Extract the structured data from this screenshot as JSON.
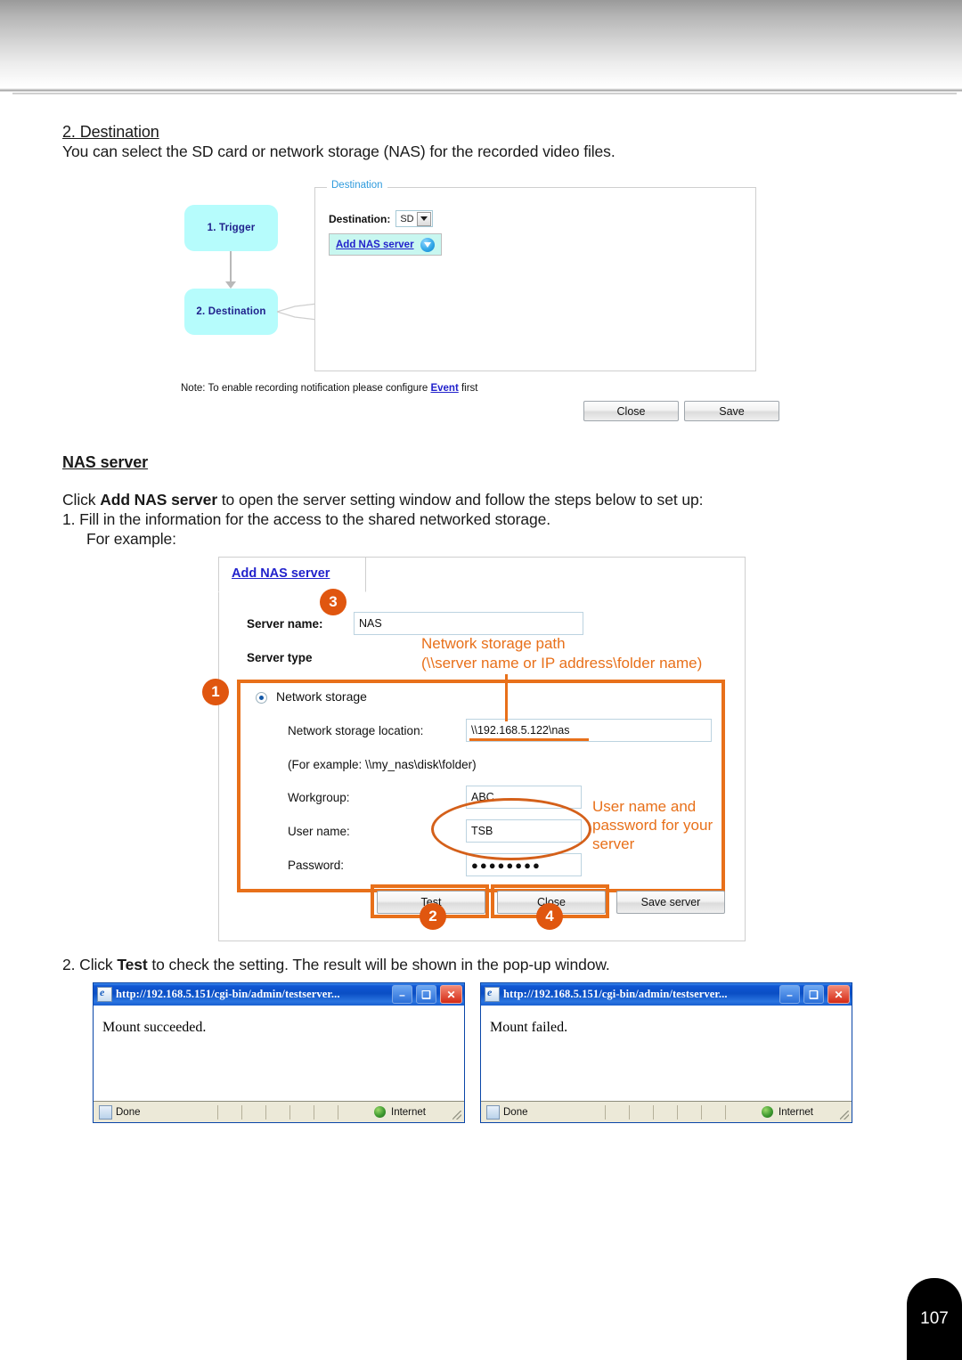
{
  "document": {
    "section_heading": "2. Destination",
    "section_intro": "You can select the SD card or network storage (NAS) for the recorded video files.",
    "nas_heading": "NAS server",
    "click_line_prefix": "Click ",
    "click_line_bold": "Add NAS server",
    "click_line_suffix": " to open the server setting window and follow the steps below to set up:",
    "step1": "1. Fill in the information for the access to the shared networked storage.",
    "step1_sub": "For example:",
    "step2_prefix": "2. Click ",
    "step2_bold": "Test",
    "step2_suffix": " to check the setting. The result will be shown in the pop-up window.",
    "page_number": "107"
  },
  "destination_window": {
    "flow": {
      "trigger": "1. Trigger",
      "destination": "2. Destination"
    },
    "fieldset_legend": "Destination",
    "destination_label": "Destination:",
    "destination_value": "SD",
    "add_nas_button": "Add NAS server",
    "note_prefix": "Note: To enable recording notification please configure ",
    "note_link": "Event",
    "note_suffix": " first",
    "close_button": "Close",
    "save_button": "Save"
  },
  "nas_dialog": {
    "tab_title": "Add NAS server",
    "server_name_label": "Server name:",
    "server_name_value": "NAS",
    "server_type_label": "Server type",
    "network_storage_radio": "Network storage",
    "network_storage_location_label": "Network storage location:",
    "network_storage_location_value": "\\\\192.168.5.122\\nas",
    "for_example": "(For example: \\\\my_nas\\disk\\folder)",
    "workgroup_label": "Workgroup:",
    "workgroup_value": "ABC",
    "username_label": "User name:",
    "username_value": "TSB",
    "password_label": "Password:",
    "password_value": "●●●●●●●●",
    "test_button": "Test",
    "close_button": "Close",
    "save_server_button": "Save server",
    "callouts": {
      "one": "1",
      "two": "2",
      "three": "3",
      "four": "4"
    },
    "annotations": {
      "path_line1": "Network storage path",
      "path_line2": "(\\\\server name or IP address\\folder name)",
      "cred_line1": "User name and",
      "cred_line2": "password for your",
      "cred_line3": "server"
    }
  },
  "popups": [
    {
      "title": "http://192.168.5.151/cgi-bin/admin/testserver...",
      "minimize_glyph": "–",
      "maximize_glyph": "❑",
      "close_glyph": "✕",
      "body_text": "Mount succeeded.",
      "status_text": "Done",
      "zone_text": "Internet"
    },
    {
      "title": "http://192.168.5.151/cgi-bin/admin/testserver...",
      "minimize_glyph": "–",
      "maximize_glyph": "❑",
      "close_glyph": "✕",
      "body_text": "Mount failed.",
      "status_text": "Done",
      "zone_text": "Internet"
    }
  ],
  "colors": {
    "accent_orange": "#e8701a",
    "callout_orange": "#e0560f",
    "flow_cyan": "#b6fcfc",
    "link_blue": "#2222cc",
    "legend_blue": "#2f9bdd",
    "ie_title_blue": "#0a4ec4"
  }
}
